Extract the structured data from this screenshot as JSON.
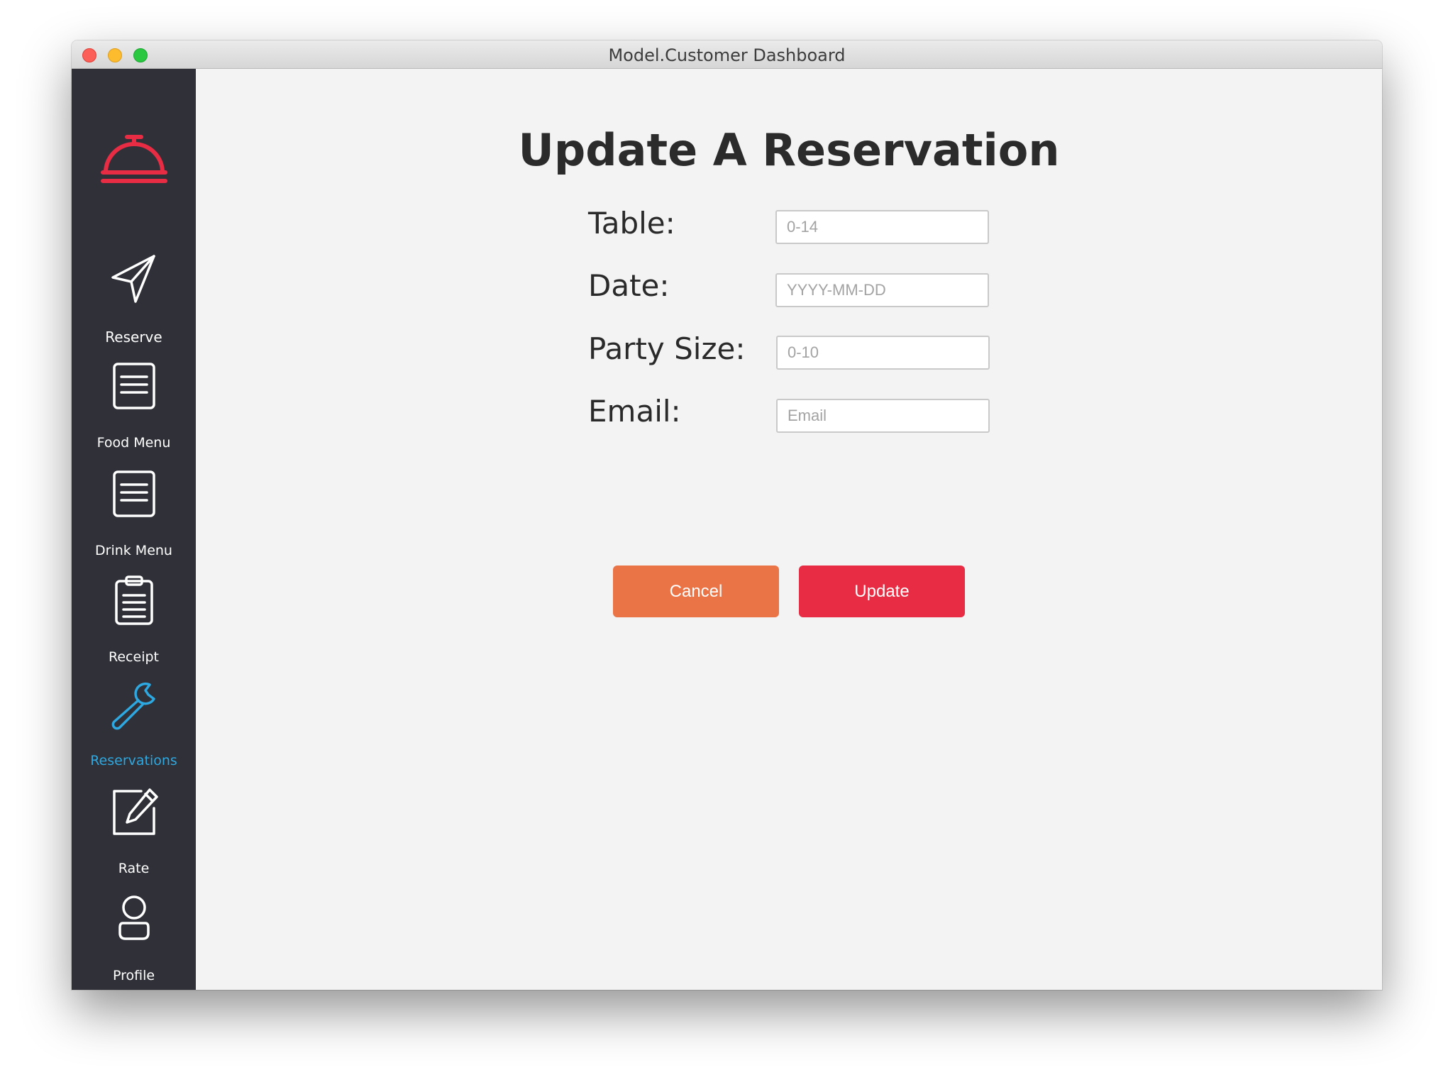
{
  "window": {
    "title": "Model.Customer Dashboard"
  },
  "sidebar": {
    "logo_icon": "service-bell-icon",
    "items": [
      {
        "label": "Reserve",
        "icon": "paper-plane-icon",
        "active": false
      },
      {
        "label": "Food Menu",
        "icon": "list-document-icon",
        "active": false
      },
      {
        "label": "Drink Menu",
        "icon": "list-document-icon",
        "active": false
      },
      {
        "label": "Receipt",
        "icon": "clipboard-icon",
        "active": false
      },
      {
        "label": "Reservations",
        "icon": "wrench-icon",
        "active": true
      },
      {
        "label": "Rate",
        "icon": "pencil-square-icon",
        "active": false
      },
      {
        "label": "Profile",
        "icon": "user-icon",
        "active": false
      }
    ]
  },
  "page": {
    "title": "Update A Reservation"
  },
  "form": {
    "table": {
      "label": "Table:",
      "placeholder": "0-14",
      "value": ""
    },
    "date": {
      "label": "Date:",
      "placeholder": "YYYY-MM-DD",
      "value": ""
    },
    "party_size": {
      "label": "Party Size:",
      "placeholder": "0-10",
      "value": ""
    },
    "email": {
      "label": "Email:",
      "placeholder": "Email",
      "value": ""
    }
  },
  "buttons": {
    "cancel": "Cancel",
    "update": "Update"
  },
  "colors": {
    "sidebar_bg": "#2f3038",
    "content_bg": "#f3f3f3",
    "active_accent": "#2ea8e0",
    "logo": "#e72c44",
    "cancel_button": "#eb7447",
    "update_button": "#e72c44"
  }
}
